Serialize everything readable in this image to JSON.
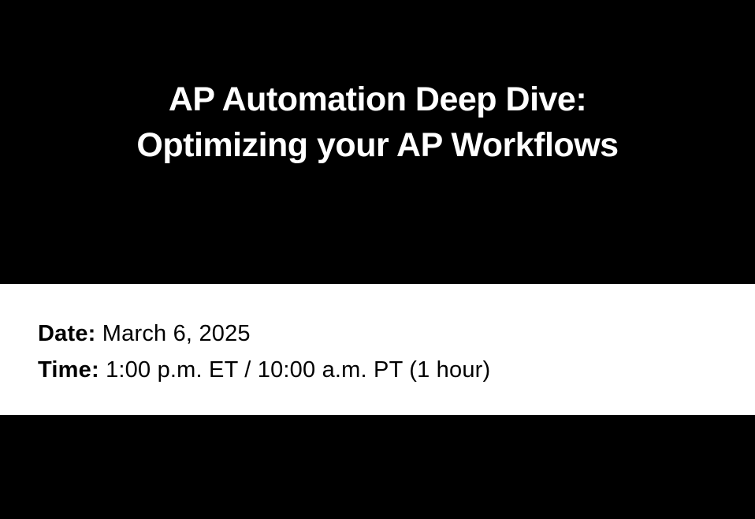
{
  "hero": {
    "title_line1": "AP Automation Deep Dive:",
    "title_line2": "Optimizing your AP Workflows"
  },
  "details": {
    "date_label": "Date:",
    "date_value": " March 6, 2025",
    "time_label": "Time:",
    "time_value": " 1:00 p.m. ET / 10:00 a.m. PT (1 hour)"
  }
}
